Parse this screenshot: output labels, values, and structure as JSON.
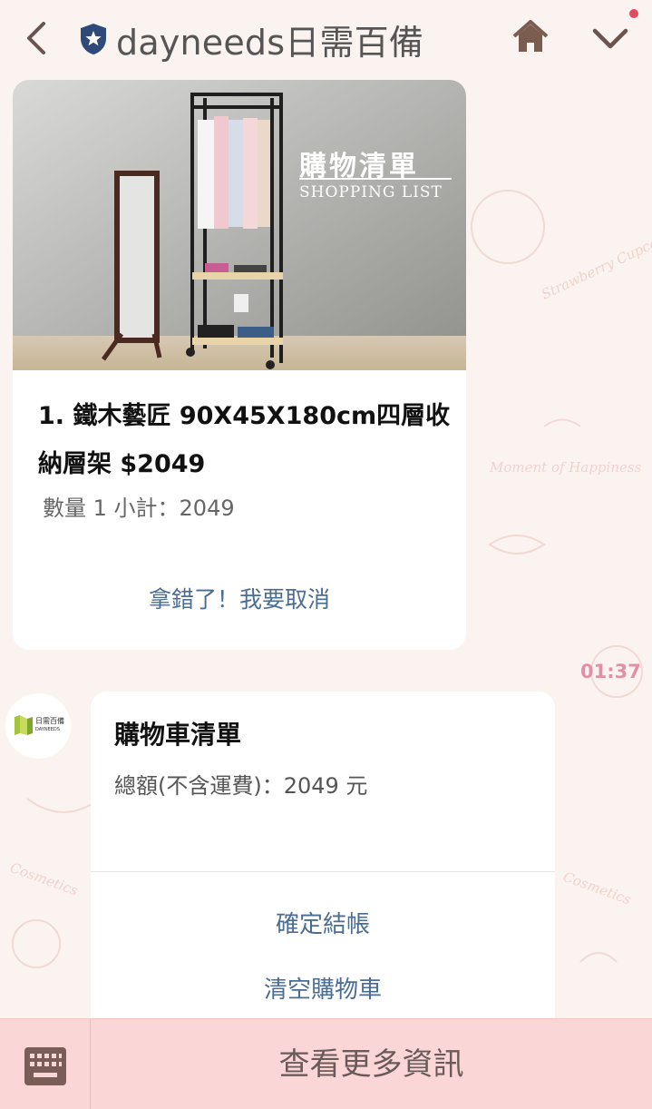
{
  "header": {
    "title": "dayneeds日需百備",
    "back_icon": "back-arrow-icon",
    "badge_icon": "verified-shield-icon",
    "home_icon": "home-icon",
    "menu_icon": "chevron-down-icon",
    "notification_dot": true
  },
  "product_card": {
    "hero_title": "購物清單",
    "hero_subtitle": "SHOPPING LIST",
    "name": "1. 鐵木藝匠 90X45X180cm四層收納層架 $2049",
    "quantity_line": "數量 1 小計：2049",
    "cancel_label": "拿錯了！我要取消"
  },
  "timestamp": "01:37",
  "avatar": {
    "brand_text": "日需百備",
    "brand_sub": "DAYNEEDS"
  },
  "cart_card": {
    "title": "購物車清單",
    "total": "總額(不含運費)：2049 元",
    "checkout_label": "確定結帳",
    "clear_label": "清空購物車"
  },
  "bottom_bar": {
    "keyboard_icon": "keyboard-icon",
    "more_label": "查看更多資訊"
  },
  "colors": {
    "accent_link": "#4a6d95",
    "timestamp": "#e290a8",
    "bottom_bar": "#fbd6d6",
    "background": "#fbf3ef"
  }
}
